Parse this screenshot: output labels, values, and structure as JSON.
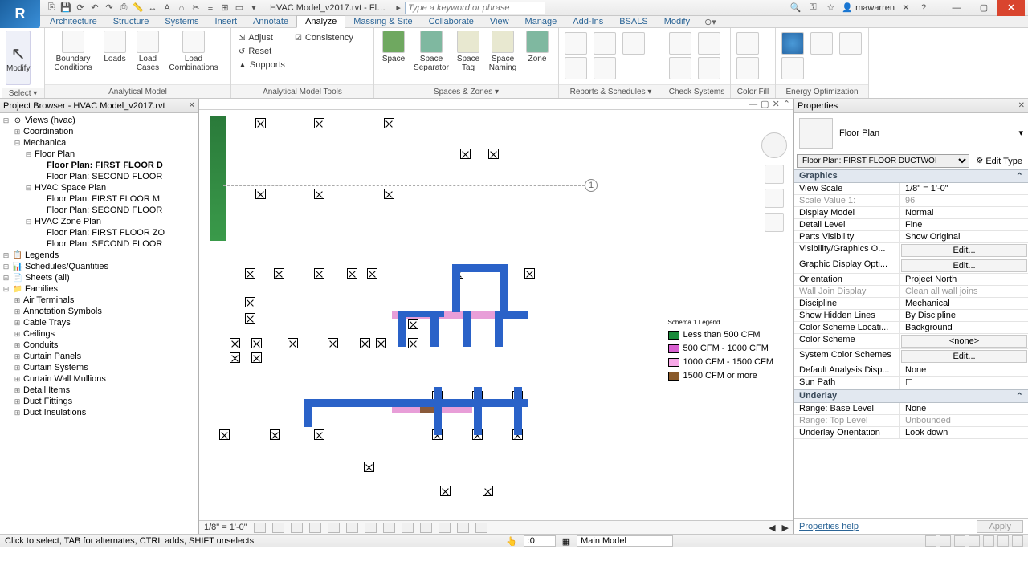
{
  "title": "HVAC Model_v2017.rvt - Fl…",
  "search_placeholder": "Type a keyword or phrase",
  "user": "mawarren",
  "tabs": [
    "Architecture",
    "Structure",
    "Systems",
    "Insert",
    "Annotate",
    "Analyze",
    "Massing & Site",
    "Collaborate",
    "View",
    "Manage",
    "Add-Ins",
    "BSALS",
    "Modify"
  ],
  "active_tab": "Analyze",
  "ribbon_groups": {
    "select": "Select ▾",
    "analytical_model": "Analytical Model",
    "analytical_model_tools": "Analytical Model Tools",
    "spaces_zones": "Spaces & Zones ▾",
    "reports_schedules": "Reports & Schedules ▾",
    "check_systems": "Check Systems",
    "color_fill": "Color Fill",
    "energy_opt": "Energy Optimization"
  },
  "ribbon_buttons": {
    "modify": "Modify",
    "boundary_conditions": "Boundary Conditions",
    "loads": "Loads",
    "load_cases": "Load Cases",
    "load_combinations": "Load Combinations",
    "adjust": "Adjust",
    "reset": "Reset",
    "supports": "Supports",
    "consistency": "Consistency",
    "space": "Space",
    "space_separator": "Space Separator",
    "space_tag": "Space Tag",
    "space_naming": "Space Naming",
    "zone": "Zone"
  },
  "project_browser": {
    "title": "Project Browser - HVAC Model_v2017.rvt",
    "root": "Views (hvac)",
    "items": {
      "coordination": "Coordination",
      "mechanical": "Mechanical",
      "floor_plan": "Floor Plan",
      "fp_first": "Floor Plan: FIRST FLOOR D",
      "fp_second": "Floor Plan: SECOND FLOOR",
      "hvac_space": "HVAC Space Plan",
      "sp_first": "Floor Plan: FIRST FLOOR M",
      "sp_second": "Floor Plan: SECOND FLOOR",
      "hvac_zone": "HVAC Zone Plan",
      "zp_first": "Floor Plan: FIRST FLOOR ZO",
      "zp_second": "Floor Plan: SECOND FLOOR",
      "legends": "Legends",
      "schedules": "Schedules/Quantities",
      "sheets": "Sheets (all)",
      "families": "Families",
      "air_terminals": "Air Terminals",
      "annotation_symbols": "Annotation Symbols",
      "cable_trays": "Cable Trays",
      "ceilings": "Ceilings",
      "conduits": "Conduits",
      "curtain_panels": "Curtain Panels",
      "curtain_systems": "Curtain Systems",
      "curtain_mullions": "Curtain Wall Mullions",
      "detail_items": "Detail Items",
      "duct_fittings": "Duct Fittings",
      "duct_insulations": "Duct Insulations"
    }
  },
  "view_scale_footer": "1/8\" = 1'-0\"",
  "legend": {
    "title": "Schema 1 Legend",
    "r1": "Less than 500 CFM",
    "r2": "500 CFM - 1000 CFM",
    "r3": "1000 CFM - 1500 CFM",
    "r4": "1500 CFM or more"
  },
  "properties": {
    "title": "Properties",
    "type_label": "Floor Plan",
    "instance_select": "Floor Plan: FIRST FLOOR DUCTWOI",
    "edit_type": "Edit Type",
    "sections": {
      "graphics": "Graphics",
      "underlay": "Underlay"
    },
    "rows": {
      "view_scale": {
        "k": "View Scale",
        "v": "1/8\" = 1'-0\""
      },
      "scale_value": {
        "k": "Scale Value    1:",
        "v": "96"
      },
      "display_model": {
        "k": "Display Model",
        "v": "Normal"
      },
      "detail_level": {
        "k": "Detail Level",
        "v": "Fine"
      },
      "parts_vis": {
        "k": "Parts Visibility",
        "v": "Show Original"
      },
      "vis_graphics": {
        "k": "Visibility/Graphics O...",
        "v": "Edit..."
      },
      "graphic_disp": {
        "k": "Graphic Display Opti...",
        "v": "Edit..."
      },
      "orientation": {
        "k": "Orientation",
        "v": "Project North"
      },
      "wall_join": {
        "k": "Wall Join Display",
        "v": "Clean all wall joins"
      },
      "discipline": {
        "k": "Discipline",
        "v": "Mechanical"
      },
      "hidden_lines": {
        "k": "Show Hidden Lines",
        "v": "By Discipline"
      },
      "color_location": {
        "k": "Color Scheme Locati...",
        "v": "Background"
      },
      "color_scheme": {
        "k": "Color Scheme",
        "v": "<none>"
      },
      "sys_color": {
        "k": "System Color Schemes",
        "v": "Edit..."
      },
      "def_analysis": {
        "k": "Default Analysis Disp...",
        "v": "None"
      },
      "sun_path": {
        "k": "Sun Path",
        "v": ""
      },
      "range_base": {
        "k": "Range: Base Level",
        "v": "None"
      },
      "range_top": {
        "k": "Range: Top Level",
        "v": "Unbounded"
      },
      "underlay_orient": {
        "k": "Underlay Orientation",
        "v": "Look down"
      }
    },
    "help": "Properties help",
    "apply": "Apply"
  },
  "grid_label": "1",
  "status": {
    "hint": "Click to select, TAB for alternates, CTRL adds, SHIFT unselects",
    "coord": ":0",
    "model": "Main Model"
  }
}
